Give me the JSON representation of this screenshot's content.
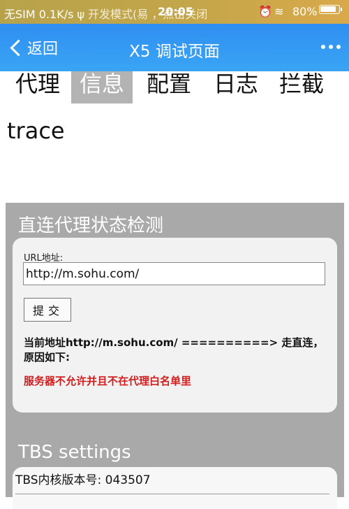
{
  "status_bar": {
    "carrier": "无SIM 0.1K/s ψ",
    "overlay_text": "开发模式(易 ，点击关闭",
    "time": "20:05",
    "battery": "80%"
  },
  "nav": {
    "back_label": "返回",
    "title": "X5 调试页面"
  },
  "tabs": [
    {
      "label": "代理",
      "active": false
    },
    {
      "label": "信息",
      "active": true
    },
    {
      "label": "配置",
      "active": false
    },
    {
      "label": "日志",
      "active": false
    },
    {
      "label": "拦截",
      "active": false
    },
    {
      "label": "trace",
      "active": false
    }
  ],
  "proxy_check": {
    "title": "直连代理状态检测",
    "url_label": "URL地址:",
    "url_value": "http://m.sohu.com/",
    "submit_label": "提交",
    "result": "当前地址http://m.sohu.com/ ==========> 走直连，原因如下:",
    "error": "服务器不允许并且不在代理白名单里"
  },
  "tbs_settings": {
    "title": "TBS settings",
    "kernel_version": "TBS内核版本号: 043507"
  }
}
